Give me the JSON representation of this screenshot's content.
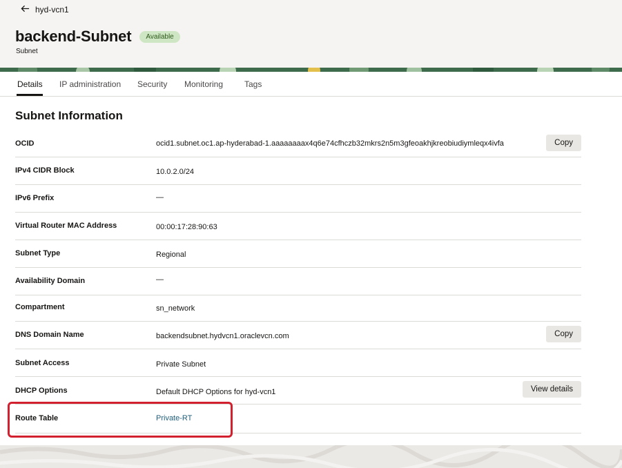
{
  "header": {
    "back_label": "hyd-vcn1",
    "title": "backend-Subnet",
    "status": "Available",
    "subtitle": "Subnet"
  },
  "tabs": [
    {
      "label": "Details",
      "active": true
    },
    {
      "label": "IP administration",
      "active": false
    },
    {
      "label": "Security",
      "active": false
    },
    {
      "label": "Monitoring",
      "active": false
    },
    {
      "label": "Tags",
      "active": false
    }
  ],
  "section_title": "Subnet Information",
  "rows": [
    {
      "label": "OCID",
      "value": "ocid1.subnet.oc1.ap-hyderabad-1.aaaaaaaax4q6e74cfhczb32mkrs2n5m3gfeoakhjkreobiudiymleqx4ivfa",
      "button": "Copy"
    },
    {
      "label": "IPv4 CIDR Block",
      "value": "10.0.2.0/24"
    },
    {
      "label": "IPv6 Prefix",
      "value": "—"
    },
    {
      "label": "Virtual Router MAC Address",
      "value": "00:00:17:28:90:63"
    },
    {
      "label": "Subnet Type",
      "value": "Regional"
    },
    {
      "label": "Availability Domain",
      "value": "—"
    },
    {
      "label": "Compartment",
      "value": "sn_network"
    },
    {
      "label": "DNS Domain Name",
      "value": "backendsubnet.hydvcn1.oraclevcn.com",
      "button": "Copy"
    },
    {
      "label": "Subnet Access",
      "value": "Private Subnet"
    },
    {
      "label": "DHCP Options",
      "value": "Default DHCP Options for hyd-vcn1",
      "button": "View details"
    },
    {
      "label": "Route Table",
      "value": "Private-RT"
    }
  ],
  "colors": {
    "badge_bg": "#cfe6c4",
    "link": "#1f5e7a",
    "highlight": "#d2202f",
    "banner": "#3f6b4d"
  },
  "icons": {
    "back": "arrow-left-icon"
  }
}
